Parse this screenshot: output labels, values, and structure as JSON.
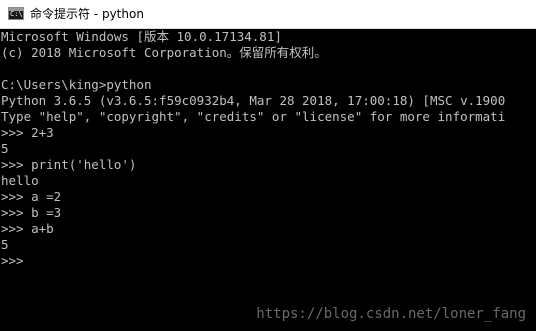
{
  "window": {
    "title": "命令提示符 - python",
    "icon": "cmd-icon",
    "icon_glyph": "C:\\",
    "background": "#000000",
    "text_color": "#c0c0c0"
  },
  "console": {
    "lines": [
      "Microsoft Windows [版本 10.0.17134.81]",
      "(c) 2018 Microsoft Corporation。保留所有权利。",
      "",
      "C:\\Users\\king>python",
      "Python 3.6.5 (v3.6.5:f59c0932b4, Mar 28 2018, 17:00:18) [MSC v.1900",
      "Type \"help\", \"copyright\", \"credits\" or \"license\" for more informati",
      ">>> 2+3",
      "5",
      ">>> print('hello')",
      "hello",
      ">>> a =2",
      ">>> b =3",
      ">>> a+b",
      "5",
      ">>>"
    ]
  },
  "watermark": {
    "text": "https://blog.csdn.net/loner_fang"
  }
}
